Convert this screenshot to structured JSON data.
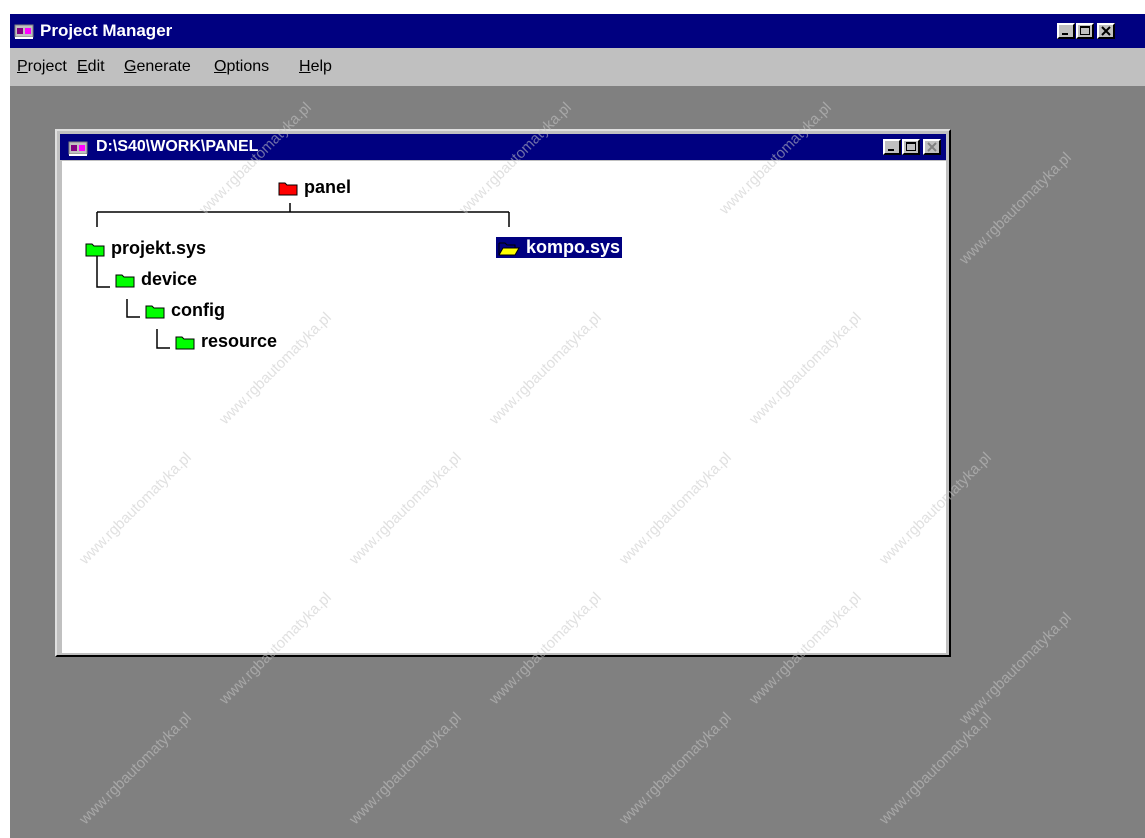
{
  "window": {
    "title": "Project Manager"
  },
  "menu": [
    {
      "label": "Project",
      "ul": "P",
      "rest": "roject"
    },
    {
      "label": "Edit",
      "ul": "E",
      "rest": "dit"
    },
    {
      "label": "Generate",
      "ul": "G",
      "rest": "enerate"
    },
    {
      "label": "Options",
      "ul": "O",
      "rest": "ptions"
    },
    {
      "label": "Help",
      "ul": "H",
      "rest": "elp"
    }
  ],
  "child_window": {
    "title": "D:\\S40\\WORK\\PANEL"
  },
  "tree": {
    "root": {
      "label": "panel",
      "color": "#ff0000"
    },
    "projekt": {
      "label": "projekt.sys",
      "color": "#00ff00"
    },
    "kompo": {
      "label": "kompo.sys",
      "color": "#ffff00",
      "selected": true
    },
    "device": {
      "label": "device",
      "color": "#00ff00"
    },
    "config": {
      "label": "config",
      "color": "#00ff00"
    },
    "resource": {
      "label": "resource",
      "color": "#00ff00"
    }
  },
  "watermark": {
    "text": "www.rgbautomatyka.pl"
  },
  "colors": {
    "titlebar": "#000080",
    "workspace": "#808080",
    "face": "#c0c0c0",
    "selection": "#000080"
  }
}
